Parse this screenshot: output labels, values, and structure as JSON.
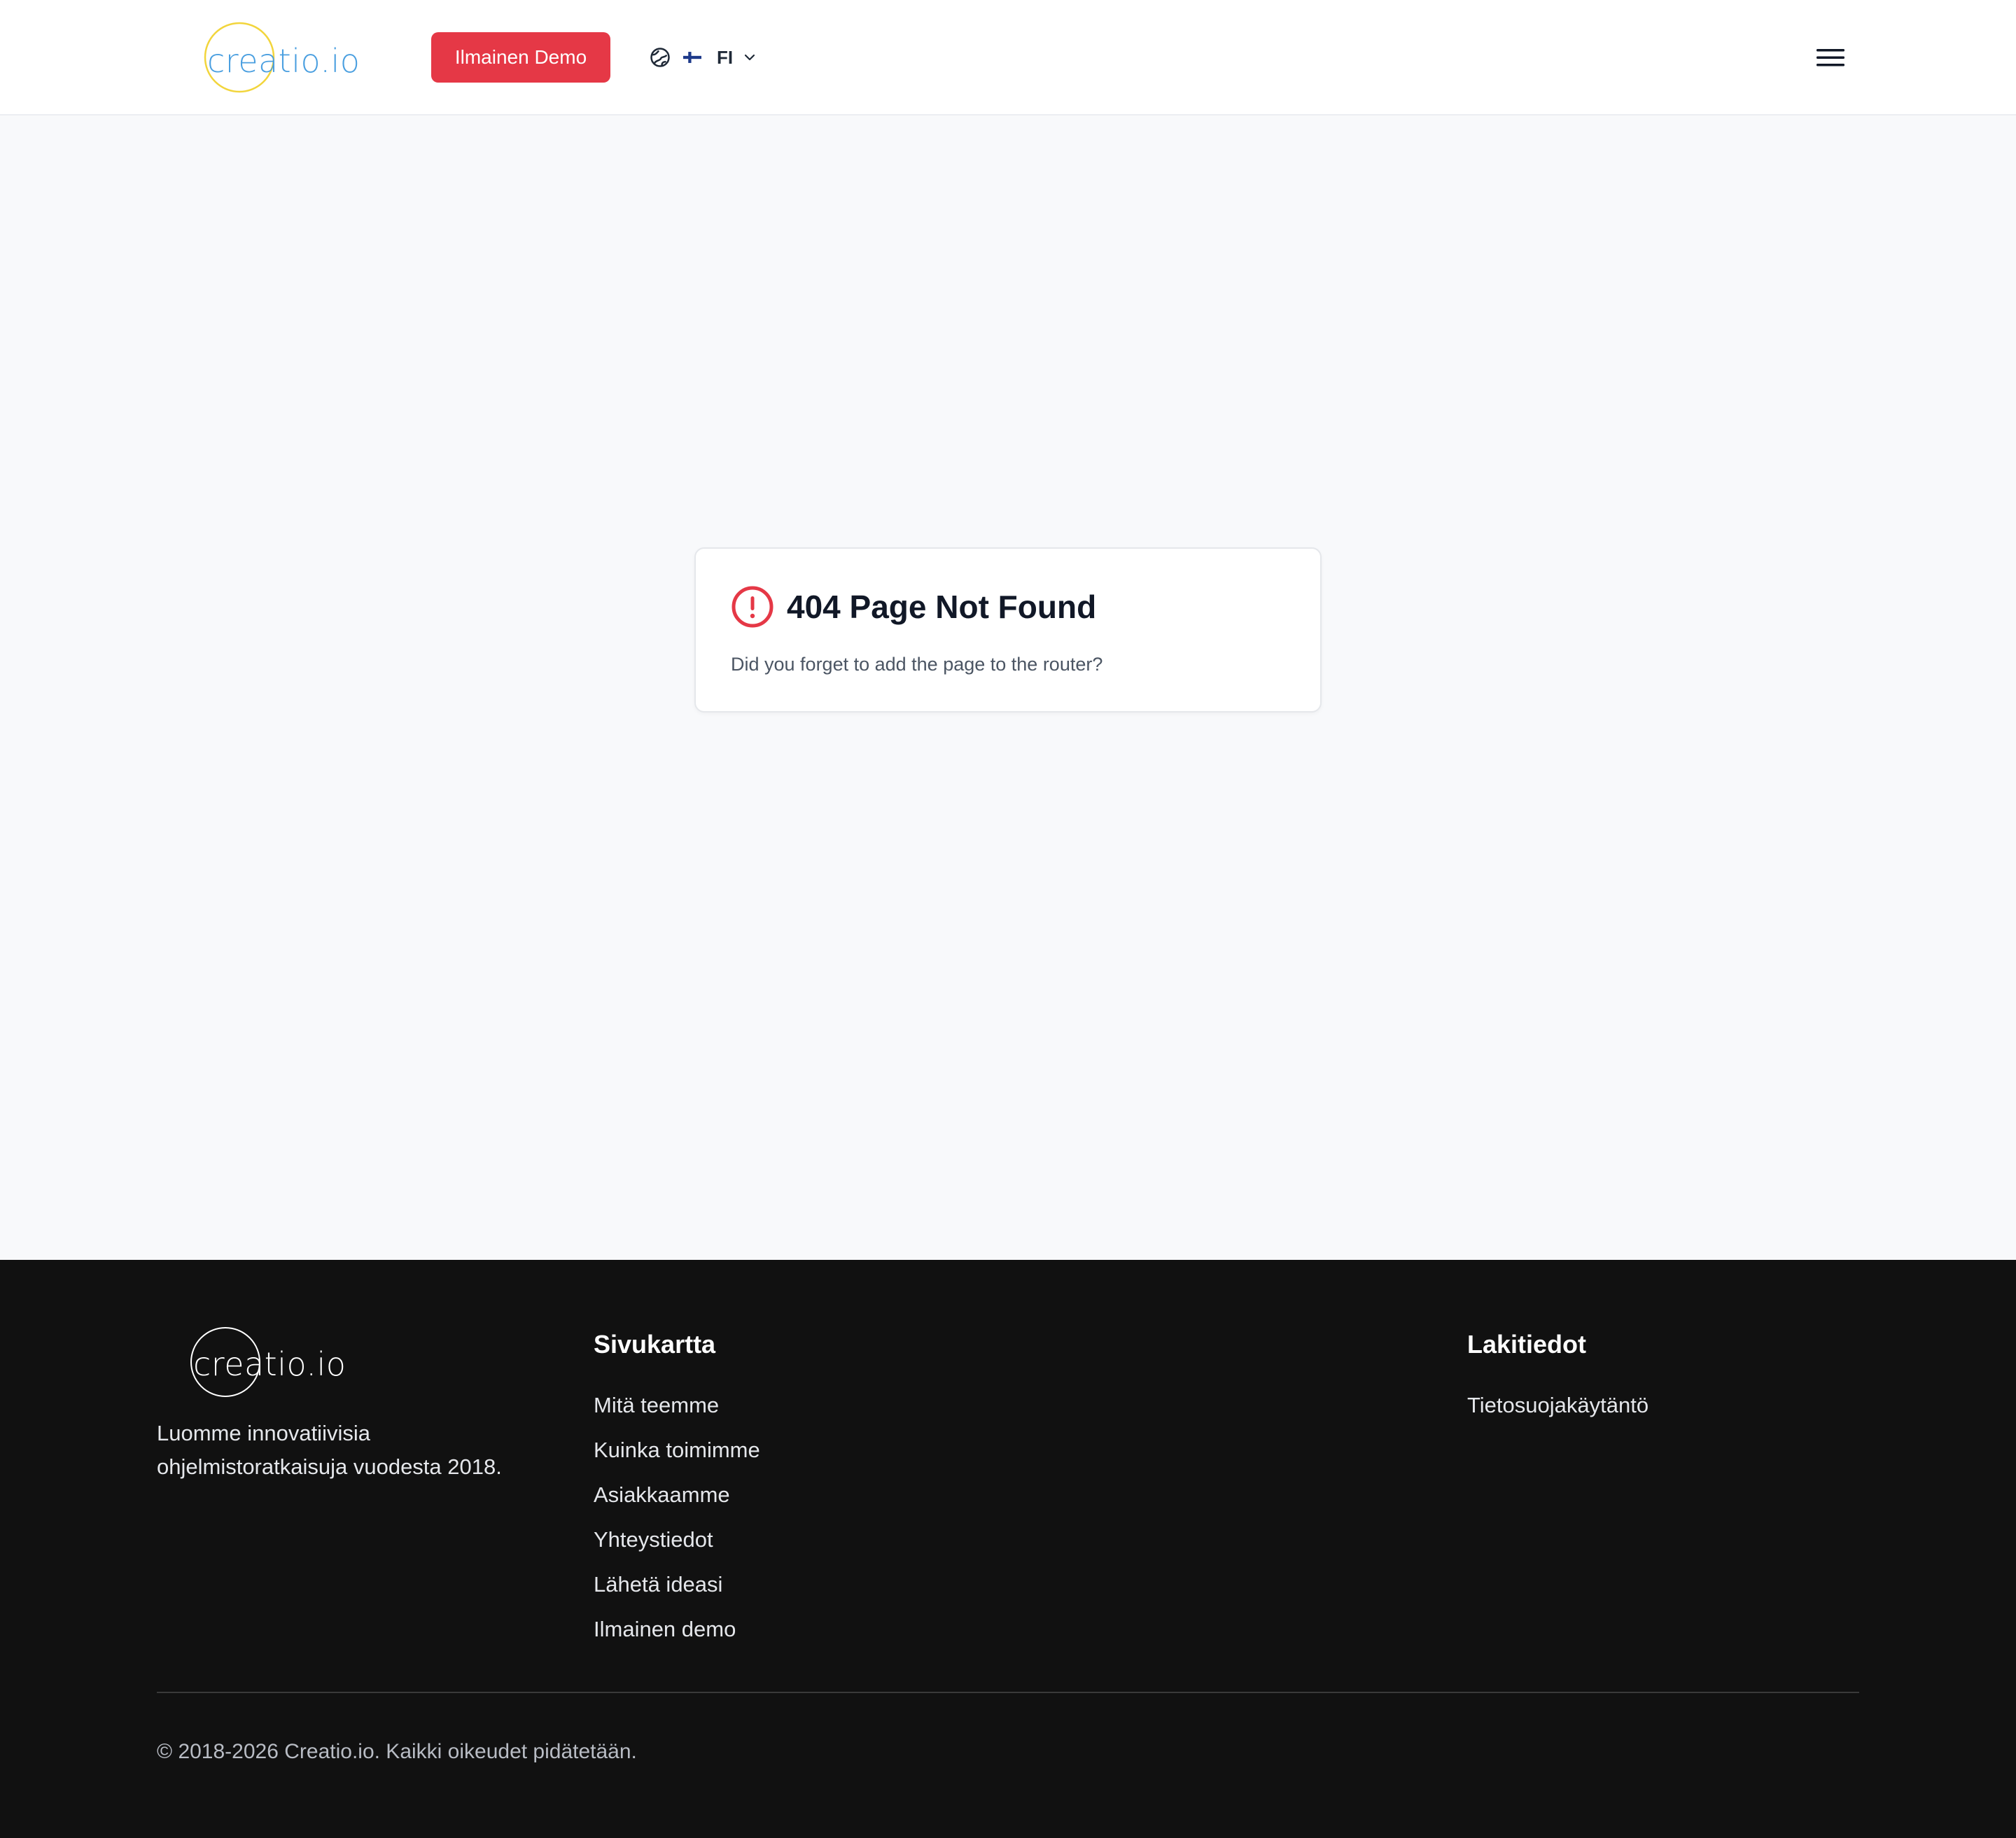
{
  "header": {
    "logo_text": "creatio.io",
    "demo_button": "Ilmainen Demo",
    "language_code": "FI",
    "icons": {
      "globe": "globe-icon",
      "flag": "finland-flag-icon",
      "chevron": "chevron-down-icon",
      "menu": "hamburger-menu-icon"
    }
  },
  "error_card": {
    "title": "404 Page Not Found",
    "description": "Did you forget to add the page to the router?",
    "icon": "alert-circle-icon"
  },
  "footer": {
    "logo_text": "creatio.io",
    "tagline": "Luomme innovatiivisia ohjelmistoratkaisuja vuodesta 2018.",
    "sitemap": {
      "title": "Sivukartta",
      "links": [
        "Mitä teemme",
        "Kuinka toimimme",
        "Asiakkaamme",
        "Yhteystiedot",
        "Lähetä ideasi",
        "Ilmainen demo"
      ]
    },
    "legal": {
      "title": "Lakitiedot",
      "links": [
        "Tietosuojakäytäntö"
      ]
    },
    "copyright": "© 2018-2026 Creatio.io. Kaikki oikeudet pidätetään."
  },
  "colors": {
    "accent": "#e53846",
    "logo_ring": "#f2d53c",
    "logo_text": "#4a9fe0",
    "footer_bg": "#111111",
    "page_bg": "#f8f9fb"
  }
}
